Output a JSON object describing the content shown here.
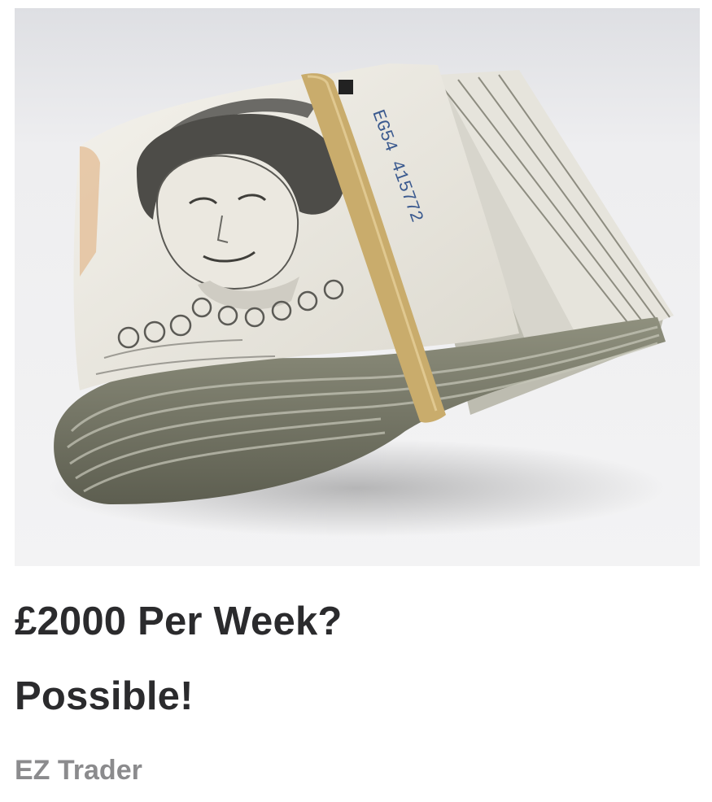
{
  "ad": {
    "headline_line1": "£2000 Per Week?",
    "headline_line2": "Possible!",
    "source": "EZ Trader",
    "image": {
      "subject": "folded-banknotes-bundle-icon",
      "serial": "EG54 415772",
      "denomination_badge": "■"
    }
  },
  "colors": {
    "headline": "#2b2b2d",
    "source": "#8b8b8d",
    "background": "#ffffff",
    "photo_background": "#e9e9ea",
    "band": "#c9ac6c"
  }
}
